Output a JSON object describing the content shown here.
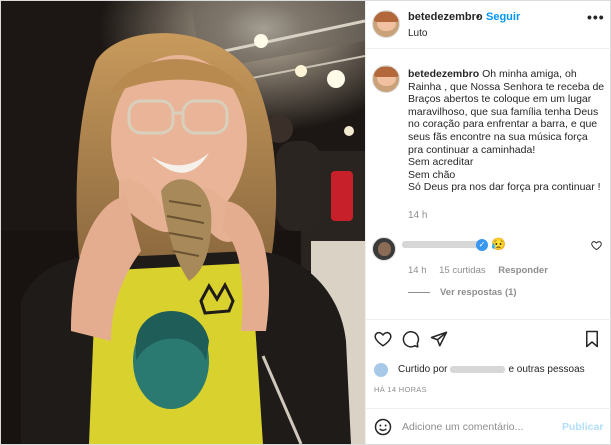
{
  "post": {
    "author": "betedezembro",
    "separator": "•",
    "follow_label": "Seguir",
    "location": "Luto",
    "more_label": "•••"
  },
  "caption": {
    "username": "betedezembro",
    "text_lines": [
      "Oh minha amiga, oh Rainha , que Nossa Senhora te receba de Braços abertos te coloque em um lugar maravilhoso, que sua família tenha Deus no coração para enfrentar a barra, e que seus fãs encontre na sua música força pra continuar a caminhada!",
      "Sem acreditar",
      "Sem chão",
      "Só Deus pra nos dar força pra continuar !"
    ],
    "time": "14 h"
  },
  "comment": {
    "emoji": "😥",
    "time": "14 h",
    "likes": "15 curtidas",
    "reply_label": "Responder",
    "view_replies": "Ver respostas (1)"
  },
  "liked_by": {
    "prefix": "Curtido por",
    "suffix": "e outras pessoas"
  },
  "post_time": "HÁ 14 HORAS",
  "add_comment": {
    "placeholder": "Adicione um comentário...",
    "publish_label": "Publicar"
  },
  "icons": {
    "like": "heart-icon",
    "comment": "comment-icon",
    "share": "paper-plane-icon",
    "save": "bookmark-icon",
    "emoji": "smiley-icon"
  },
  "colors": {
    "accent": "#0095f6",
    "publish_disabled": "#b2dffc",
    "muted": "#8e8e8e",
    "text": "#262626"
  }
}
